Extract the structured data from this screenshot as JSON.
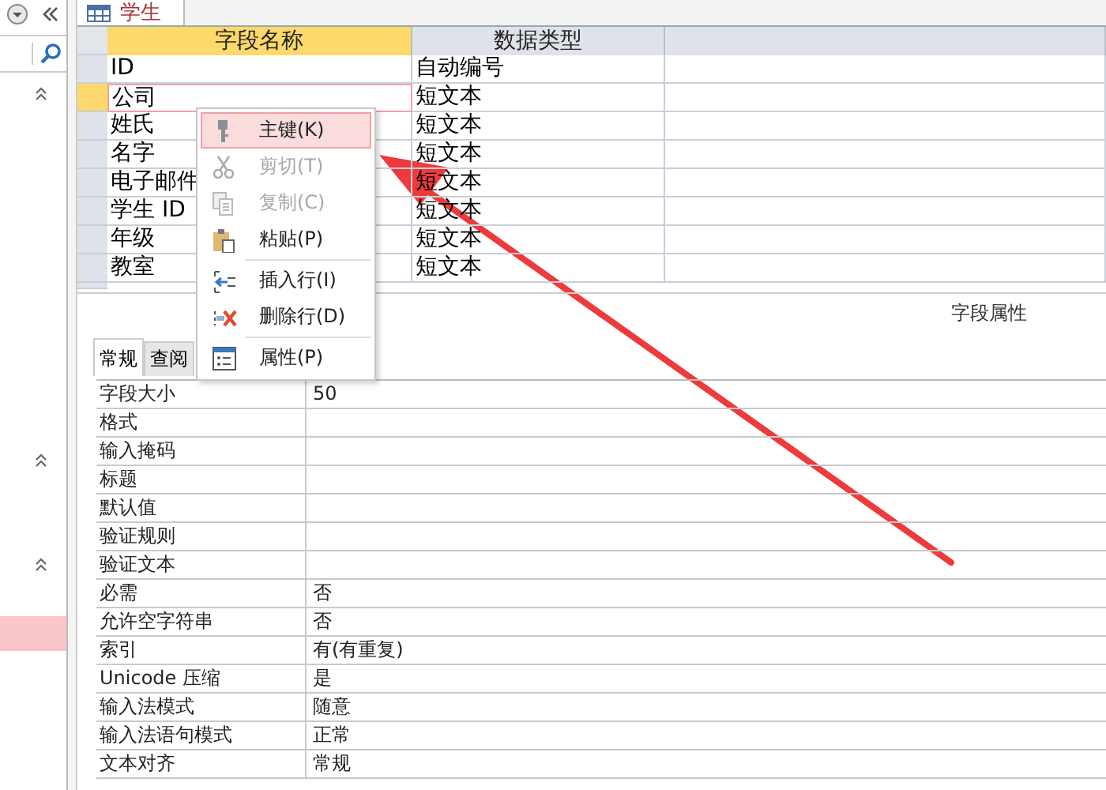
{
  "navigation_pane": {
    "highlighted_item": true
  },
  "document_tab": {
    "title": "学生",
    "selected": true
  },
  "design_grid": {
    "columns": [
      {
        "label": "字段名称",
        "selected": true
      },
      {
        "label": "数据类型",
        "selected": false
      },
      {
        "selected": false
      }
    ],
    "rows": [
      {
        "field_name": "ID",
        "data_type": "自动编号",
        "selected": false
      },
      {
        "field_name": "公司",
        "data_type": "短文本",
        "selected": true
      },
      {
        "field_name": "姓氏",
        "data_type": "短文本",
        "selected": false
      },
      {
        "field_name": "名字",
        "data_type": "短文本",
        "selected": false
      },
      {
        "field_name": "电子邮件",
        "data_type": "短文本",
        "selected": false
      },
      {
        "field_name": "学生 ID",
        "data_type": "短文本",
        "selected": false
      },
      {
        "field_name": "年级",
        "data_type": "短文本",
        "selected": false
      },
      {
        "field_name": "教室",
        "data_type": "短文本",
        "selected": false
      }
    ]
  },
  "field_properties": {
    "title": "字段属性",
    "tabs": [
      {
        "label": "常规",
        "selected": true
      },
      {
        "label": "查阅",
        "selected": false
      }
    ],
    "rows": [
      {
        "label": "字段大小",
        "value": "50"
      },
      {
        "label": "格式",
        "value": ""
      },
      {
        "label": "输入掩码",
        "value": ""
      },
      {
        "label": "标题",
        "value": ""
      },
      {
        "label": "默认值",
        "value": ""
      },
      {
        "label": "验证规则",
        "value": ""
      },
      {
        "label": "验证文本",
        "value": ""
      },
      {
        "label": "必需",
        "value": "否"
      },
      {
        "label": "允许空字符串",
        "value": "否"
      },
      {
        "label": "索引",
        "value": "有(有重复)"
      },
      {
        "label": "Unicode 压缩",
        "value": "是"
      },
      {
        "label": "输入法模式",
        "value": "随意"
      },
      {
        "label": "输入法语句模式",
        "value": "正常"
      },
      {
        "label": "文本对齐",
        "value": "常规"
      }
    ]
  },
  "context_menu": {
    "items": [
      {
        "kind": "item",
        "label": "主键(K)",
        "selected": true,
        "disabled": false
      },
      {
        "kind": "item",
        "label": "剪切(T)",
        "selected": false,
        "disabled": true
      },
      {
        "kind": "item",
        "label": "复制(C)",
        "selected": false,
        "disabled": true
      },
      {
        "kind": "item",
        "label": "粘贴(P)",
        "selected": false,
        "disabled": false
      },
      {
        "kind": "separator"
      },
      {
        "kind": "item",
        "label": "插入行(I)",
        "selected": false,
        "disabled": false
      },
      {
        "kind": "item",
        "label": "删除行(D)",
        "selected": false,
        "disabled": false
      },
      {
        "kind": "separator"
      },
      {
        "kind": "item",
        "label": "属性(P)",
        "selected": false,
        "disabled": false
      }
    ]
  }
}
